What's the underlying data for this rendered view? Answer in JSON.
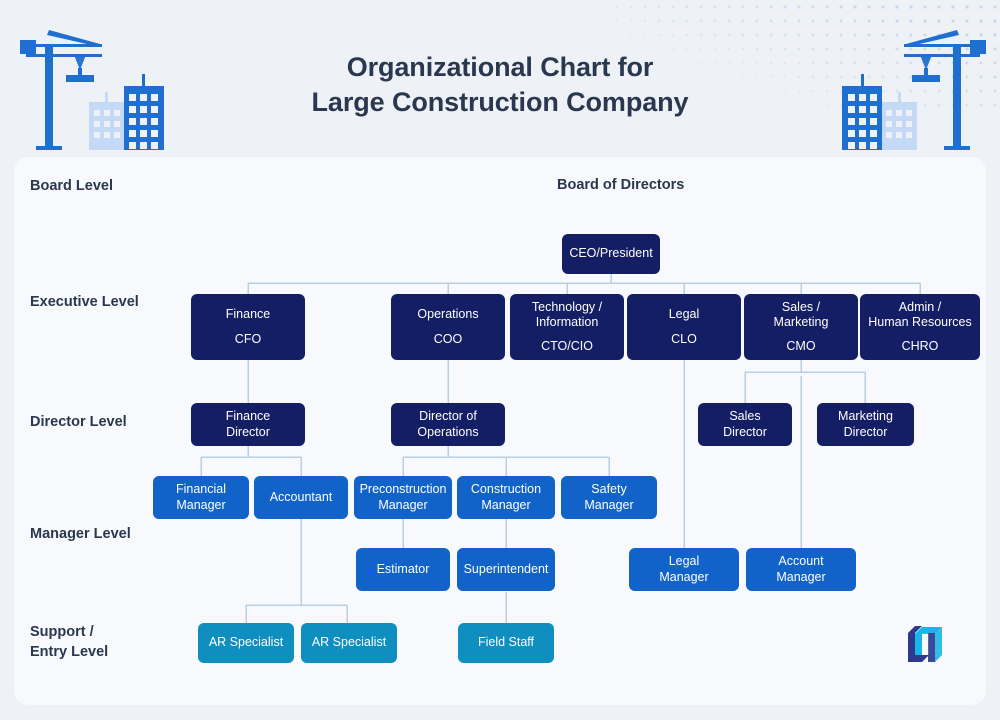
{
  "header": {
    "title_line1": "Organizational Chart for",
    "title_line2": "Large Construction Company",
    "left_art": "construction-crane-buildings",
    "right_art": "construction-crane-buildings",
    "dot_pattern": "halftone-dots"
  },
  "colors": {
    "page_bg": "#eef2f7",
    "card_bg": "#f7f9fc",
    "title": "#29374f",
    "tier_navy": "#141e64",
    "tier_blue": "#1162c9",
    "tier_cyan": "#0e8fbf",
    "connector": "#b9cfe4",
    "art_blue": "#1f6fd0",
    "art_blue_light": "#c3d9f5",
    "logo_navy": "#2d3a8c",
    "logo_cyan": "#18b6e8"
  },
  "levels": [
    {
      "id": "board",
      "label": "Board Level"
    },
    {
      "id": "executive",
      "label": "Executive Level"
    },
    {
      "id": "director",
      "label": "Director Level"
    },
    {
      "id": "manager",
      "label": "Manager Level"
    },
    {
      "id": "support",
      "label": "Support /\nEntry Level"
    }
  ],
  "board_heading": "Board of Directors",
  "chart_data": {
    "type": "diagram",
    "title": "Organizational Chart for Large Construction Company",
    "nodes": [
      {
        "id": "ceo",
        "title": "CEO/President",
        "sub": "",
        "tier": "navy",
        "level": "board"
      },
      {
        "id": "cfo",
        "title": "Finance",
        "sub": "CFO",
        "tier": "navy",
        "level": "executive"
      },
      {
        "id": "coo",
        "title": "Operations",
        "sub": "COO",
        "tier": "navy",
        "level": "executive"
      },
      {
        "id": "cto",
        "title": "Technology /\nInformation",
        "sub": "CTO/CIO",
        "tier": "navy",
        "level": "executive"
      },
      {
        "id": "clo",
        "title": "Legal",
        "sub": "CLO",
        "tier": "navy",
        "level": "executive"
      },
      {
        "id": "cmo",
        "title": "Sales /\nMarketing",
        "sub": "CMO",
        "tier": "navy",
        "level": "executive"
      },
      {
        "id": "chro",
        "title": "Admin /\nHuman Resources",
        "sub": "CHRO",
        "tier": "navy",
        "level": "executive"
      },
      {
        "id": "findir",
        "title": "Finance\nDirector",
        "sub": "",
        "tier": "navy",
        "level": "director"
      },
      {
        "id": "opsdir",
        "title": "Director of\nOperations",
        "sub": "",
        "tier": "navy",
        "level": "director"
      },
      {
        "id": "salesdir",
        "title": "Sales\nDirector",
        "sub": "",
        "tier": "navy",
        "level": "director"
      },
      {
        "id": "mktdir",
        "title": "Marketing\nDirector",
        "sub": "",
        "tier": "navy",
        "level": "director"
      },
      {
        "id": "finmgr",
        "title": "Financial\nManager",
        "sub": "",
        "tier": "blue",
        "level": "manager"
      },
      {
        "id": "acct",
        "title": "Accountant",
        "sub": "",
        "tier": "blue",
        "level": "manager"
      },
      {
        "id": "preconmgr",
        "title": "Preconstruction\nManager",
        "sub": "",
        "tier": "blue",
        "level": "manager"
      },
      {
        "id": "conmgr",
        "title": "Construction\nManager",
        "sub": "",
        "tier": "blue",
        "level": "manager"
      },
      {
        "id": "safemgr",
        "title": "Safety\nManager",
        "sub": "",
        "tier": "blue",
        "level": "manager"
      },
      {
        "id": "estimator",
        "title": "Estimator",
        "sub": "",
        "tier": "blue",
        "level": "manager"
      },
      {
        "id": "superint",
        "title": "Superintendent",
        "sub": "",
        "tier": "blue",
        "level": "manager"
      },
      {
        "id": "legalmgr",
        "title": "Legal\nManager",
        "sub": "",
        "tier": "blue",
        "level": "manager"
      },
      {
        "id": "acctmgr",
        "title": "Account\nManager",
        "sub": "",
        "tier": "blue",
        "level": "manager"
      },
      {
        "id": "ar1",
        "title": "AR Specialist",
        "sub": "",
        "tier": "cyan",
        "level": "support"
      },
      {
        "id": "ar2",
        "title": "AR Specialist",
        "sub": "",
        "tier": "cyan",
        "level": "support"
      },
      {
        "id": "field",
        "title": "Field Staff",
        "sub": "",
        "tier": "cyan",
        "level": "support"
      }
    ],
    "edges": [
      {
        "from": "ceo",
        "to": "cfo"
      },
      {
        "from": "ceo",
        "to": "coo"
      },
      {
        "from": "ceo",
        "to": "cto"
      },
      {
        "from": "ceo",
        "to": "clo"
      },
      {
        "from": "ceo",
        "to": "cmo"
      },
      {
        "from": "ceo",
        "to": "chro"
      },
      {
        "from": "cfo",
        "to": "findir"
      },
      {
        "from": "coo",
        "to": "opsdir"
      },
      {
        "from": "cmo",
        "to": "salesdir"
      },
      {
        "from": "cmo",
        "to": "mktdir"
      },
      {
        "from": "findir",
        "to": "finmgr"
      },
      {
        "from": "findir",
        "to": "acct"
      },
      {
        "from": "opsdir",
        "to": "preconmgr"
      },
      {
        "from": "opsdir",
        "to": "conmgr"
      },
      {
        "from": "opsdir",
        "to": "safemgr"
      },
      {
        "from": "preconmgr",
        "to": "estimator"
      },
      {
        "from": "conmgr",
        "to": "superint"
      },
      {
        "from": "clo",
        "to": "legalmgr"
      },
      {
        "from": "cmo",
        "to": "acctmgr"
      },
      {
        "from": "acct",
        "to": "ar1"
      },
      {
        "from": "acct",
        "to": "ar2"
      },
      {
        "from": "superint",
        "to": "field"
      }
    ]
  },
  "logo": "company-logo"
}
